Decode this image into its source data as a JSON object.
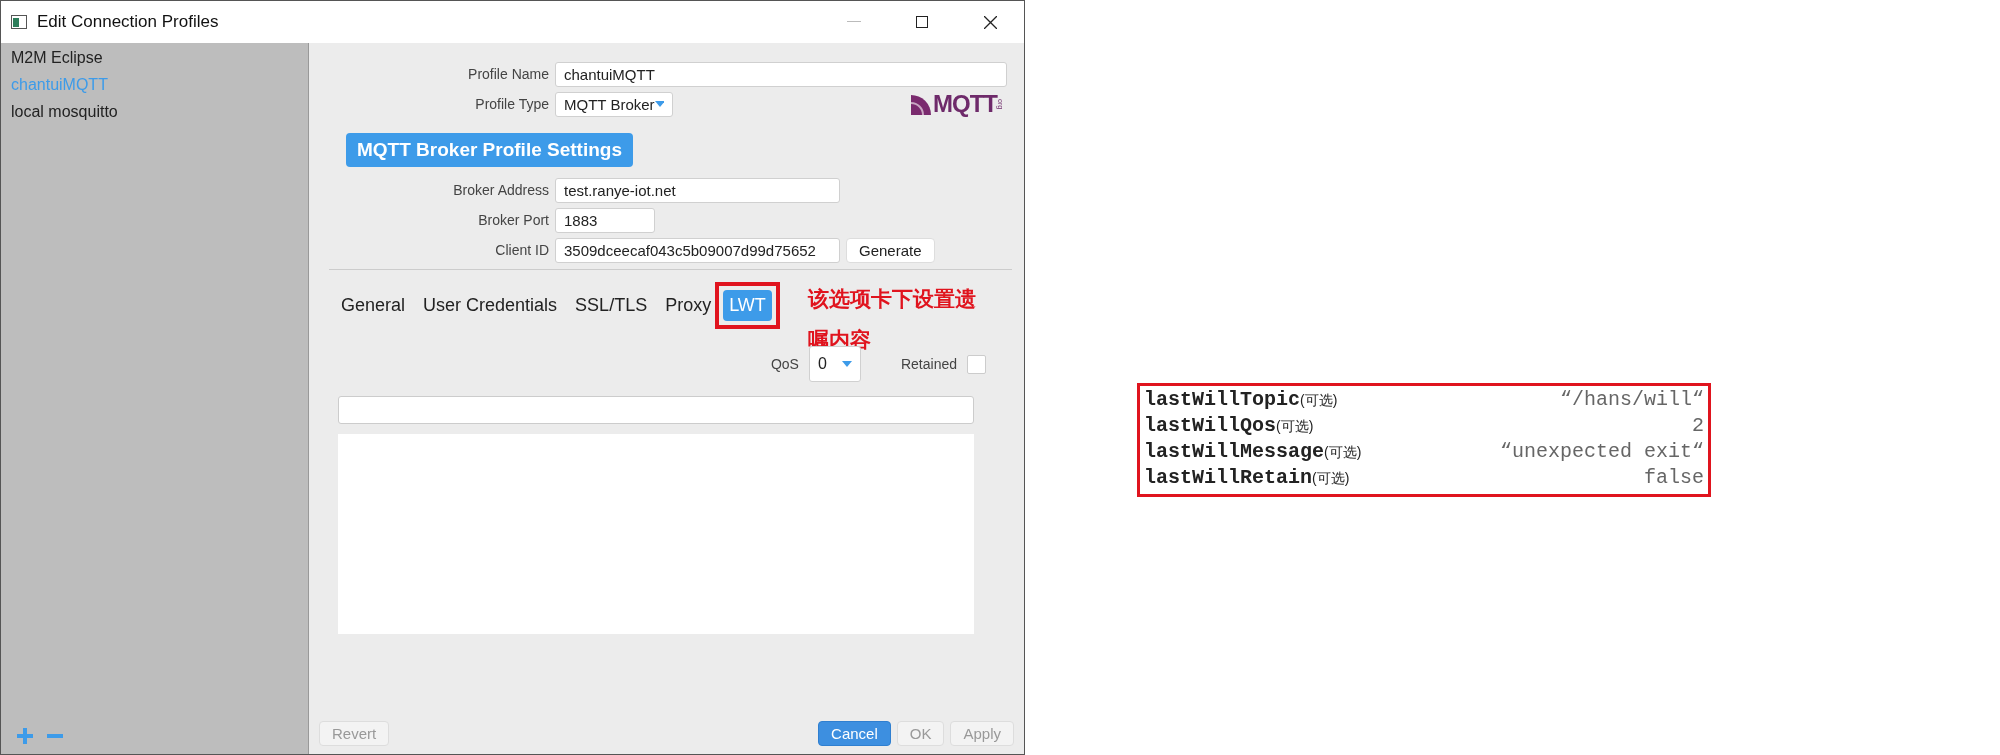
{
  "window": {
    "title": "Edit Connection Profiles"
  },
  "sidebar": {
    "items": [
      {
        "label": "M2M Eclipse",
        "selected": false
      },
      {
        "label": "chantuiMQTT",
        "selected": true
      },
      {
        "label": "local mosquitto",
        "selected": false
      }
    ]
  },
  "profile": {
    "name_label": "Profile Name",
    "name_value": "chantuiMQTT",
    "type_label": "Profile Type",
    "type_value": "MQTT Broker",
    "logo_text": "MQTT",
    "logo_suffix": "org"
  },
  "section_title": "MQTT Broker Profile Settings",
  "broker_fields": [
    {
      "kind": "wide",
      "label": "Broker Address",
      "value": "test.ranye-iot.net"
    },
    {
      "kind": "short",
      "label": "Broker Port",
      "value": "1883"
    },
    {
      "kind": "wide",
      "label": "Client ID",
      "value": "3509dceecaf043c5b09007d99d75652"
    }
  ],
  "generate_button": "Generate",
  "tabs": [
    {
      "label": "General",
      "selected": false
    },
    {
      "label": "User Credentials",
      "selected": false
    },
    {
      "label": "SSL/TLS",
      "selected": false
    },
    {
      "label": "Proxy",
      "selected": false
    },
    {
      "label": "LWT",
      "selected": true,
      "highlighted": true
    }
  ],
  "annotation": "该选项卡下设置遗嘱内容",
  "lwt": {
    "qos_label": "QoS",
    "qos_value": "0",
    "retained_label": "Retained",
    "retained_checked": false
  },
  "footer": {
    "revert": {
      "label": "Revert",
      "disabled": true
    },
    "buttons": [
      {
        "label": "Cancel",
        "kind": "primary",
        "disabled": false
      },
      {
        "label": "OK",
        "kind": "plain",
        "disabled": true
      },
      {
        "label": "Apply",
        "kind": "plain",
        "disabled": true
      }
    ]
  },
  "options": [
    {
      "name": "lastWillTopic",
      "note": "(可选)",
      "value": "“/hans/will“"
    },
    {
      "name": "lastWillQos",
      "note": "(可选)",
      "value": "2"
    },
    {
      "name": "lastWillMessage",
      "note": "(可选)",
      "value": "“unexpected exit“"
    },
    {
      "name": "lastWillRetain",
      "note": "(可选)",
      "value": "false"
    }
  ]
}
